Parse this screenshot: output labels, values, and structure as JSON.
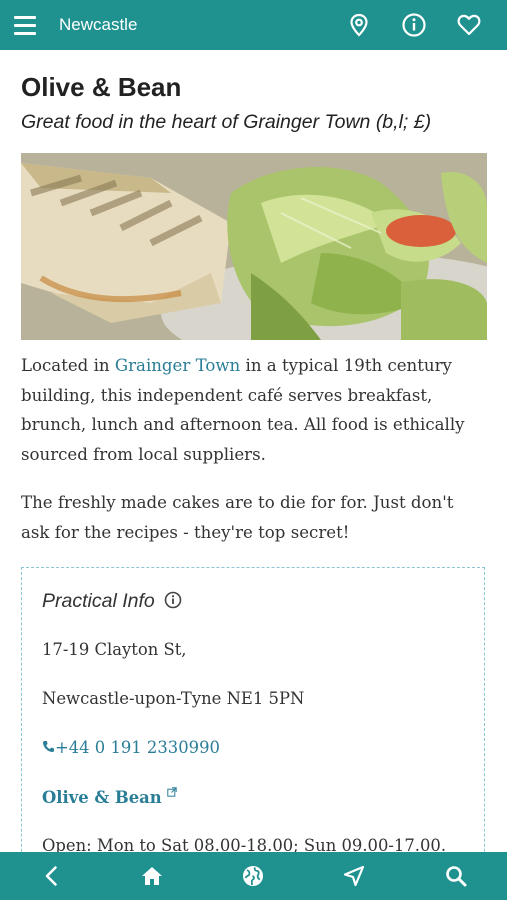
{
  "header": {
    "title": "Newcastle",
    "icons": [
      "menu-icon",
      "location-pin-icon",
      "info-icon",
      "heart-icon"
    ]
  },
  "place": {
    "name": "Olive & Bean",
    "tagline": "Great food in the heart of Grainger Town (b,l; £)",
    "photo_icon": "food-photo"
  },
  "description": {
    "p1_before": "Located in ",
    "p1_link": "Grainger Town",
    "p1_after": " in a typical 19th century building, this independent café serves breakfast, brunch, lunch and afternoon tea. All food is ethically sourced from local suppliers.",
    "p2": "The freshly made cakes are to die for for. Just don't ask for the recipes - they're top secret!"
  },
  "practical_info": {
    "title": "Practical Info",
    "address_line1": "17-19 Clayton St,",
    "address_line2": "Newcastle-upon-Tyne NE1 5PN",
    "phone": "+44 0 191 2330990",
    "website": "Olive & Bean",
    "hours": "Open: Mon to Sat 08.00-18.00; Sun 09.00-17.00."
  },
  "bottom_nav": {
    "icons": [
      "back-icon",
      "home-icon",
      "globe-icon",
      "navigate-icon",
      "search-icon"
    ]
  },
  "colors": {
    "brand": "#1f9290",
    "link": "#2a7d96"
  }
}
